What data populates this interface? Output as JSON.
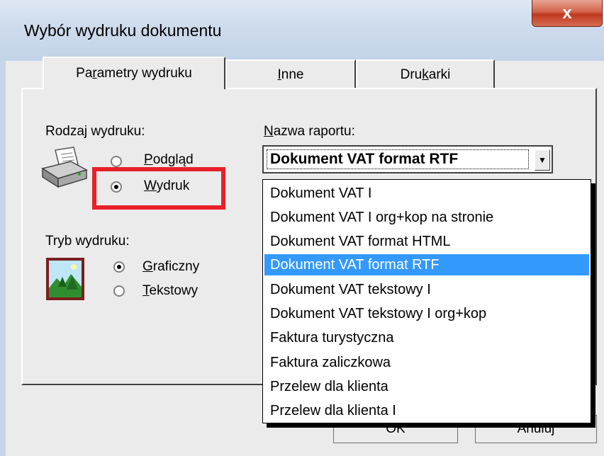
{
  "window": {
    "title": "Wybór wydruku dokumentu",
    "close_label": "x"
  },
  "tabs": [
    {
      "label_pre": "Pa",
      "label_ul": "r",
      "label_post": "ametry wydruku",
      "active": true
    },
    {
      "label_pre": "",
      "label_ul": "I",
      "label_post": "nne",
      "active": false
    },
    {
      "label_pre": "Dru",
      "label_ul": "k",
      "label_post": "arki",
      "active": false
    }
  ],
  "print_type": {
    "label": "Rodzaj wydruku:",
    "options": [
      {
        "label_ul": "P",
        "label_post": "odgląd",
        "checked": false
      },
      {
        "label_ul": "W",
        "label_post": "ydruk",
        "checked": true
      }
    ]
  },
  "print_mode": {
    "label": "Tryb wydruku:",
    "options": [
      {
        "label_ul": "G",
        "label_post": "raficzny",
        "checked": true
      },
      {
        "label_ul": "T",
        "label_post": "ekstowy",
        "checked": false
      }
    ]
  },
  "report": {
    "label_ul": "N",
    "label_post": "azwa raportu:",
    "selected": "Dokument VAT format RTF",
    "options": [
      "Dokument VAT I",
      "Dokument VAT I org+kop na stronie",
      "Dokument VAT format HTML",
      "Dokument VAT format RTF",
      "Dokument VAT tekstowy I",
      "Dokument VAT tekstowy I org+kop",
      "Faktura turystyczna",
      "Faktura zaliczkowa",
      "Przelew dla klienta",
      "Przelew dla klienta I"
    ],
    "selected_index": 3
  },
  "buttons": {
    "ok": "OK",
    "cancel": "Anuluj"
  },
  "colors": {
    "highlight": "#e8202a",
    "selection": "#3399ff"
  }
}
